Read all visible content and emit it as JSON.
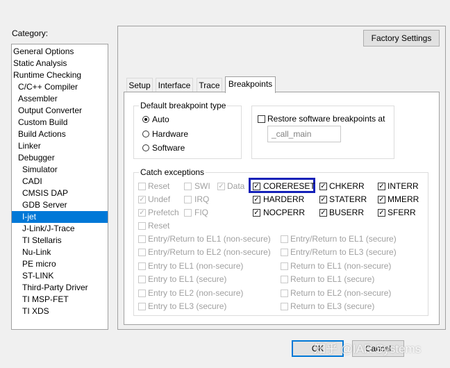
{
  "category": {
    "label": "Category:",
    "items": [
      {
        "label": "General Options",
        "level": 0
      },
      {
        "label": "Static Analysis",
        "level": 0
      },
      {
        "label": "Runtime Checking",
        "level": 0
      },
      {
        "label": "C/C++ Compiler",
        "level": 1
      },
      {
        "label": "Assembler",
        "level": 1
      },
      {
        "label": "Output Converter",
        "level": 1
      },
      {
        "label": "Custom Build",
        "level": 1
      },
      {
        "label": "Build Actions",
        "level": 1
      },
      {
        "label": "Linker",
        "level": 1
      },
      {
        "label": "Debugger",
        "level": 1
      },
      {
        "label": "Simulator",
        "level": 2
      },
      {
        "label": "CADI",
        "level": 2
      },
      {
        "label": "CMSIS DAP",
        "level": 2
      },
      {
        "label": "GDB Server",
        "level": 2
      },
      {
        "label": "I-jet",
        "level": 2,
        "selected": true
      },
      {
        "label": "J-Link/J-Trace",
        "level": 2
      },
      {
        "label": "TI Stellaris",
        "level": 2
      },
      {
        "label": "Nu-Link",
        "level": 2
      },
      {
        "label": "PE micro",
        "level": 2
      },
      {
        "label": "ST-LINK",
        "level": 2
      },
      {
        "label": "Third-Party Driver",
        "level": 2
      },
      {
        "label": "TI MSP-FET",
        "level": 2
      },
      {
        "label": "TI XDS",
        "level": 2
      }
    ]
  },
  "factory_settings": "Factory Settings",
  "tabs": [
    "Setup",
    "Interface",
    "Trace",
    "Breakpoints"
  ],
  "active_tab": "Breakpoints",
  "default_bp": {
    "title": "Default breakpoint type",
    "options": [
      {
        "label": "Auto",
        "selected": true
      },
      {
        "label": "Hardware",
        "selected": false
      },
      {
        "label": "Software",
        "selected": false
      }
    ]
  },
  "restore_bp": {
    "label": "Restore software breakpoints at",
    "checked": false,
    "value": "_call_main"
  },
  "catch": {
    "title": "Catch exceptions",
    "disabled_row1": [
      {
        "label": "Reset",
        "checked": false
      },
      {
        "label": "SWI",
        "checked": false
      },
      {
        "label": "Data",
        "checked": true
      }
    ],
    "disabled_row2": [
      {
        "label": "Undef",
        "checked": true
      },
      {
        "label": "IRQ",
        "checked": false
      }
    ],
    "disabled_row3": [
      {
        "label": "Prefetch",
        "checked": true
      },
      {
        "label": "FIQ",
        "checked": false
      }
    ],
    "disabled_row4": [
      {
        "label": "Reset",
        "checked": false
      }
    ],
    "active": [
      {
        "label": "CORERESET",
        "checked": true
      },
      {
        "label": "CHKERR",
        "checked": true
      },
      {
        "label": "INTERR",
        "checked": true
      },
      {
        "label": "HARDERR",
        "checked": true
      },
      {
        "label": "STATERR",
        "checked": true
      },
      {
        "label": "MMERR",
        "checked": true
      },
      {
        "label": "NOCPERR",
        "checked": true
      },
      {
        "label": "BUSERR",
        "checked": true
      },
      {
        "label": "SFERR",
        "checked": true
      }
    ],
    "el_left": [
      "Entry/Return to EL1 (non-secure)",
      "Entry/Return to EL2 (non-secure)",
      "Entry to EL1 (non-secure)",
      "Entry to EL1 (secure)",
      "Entry to EL2 (non-secure)",
      "Entry to EL3 (secure)"
    ],
    "el_right": [
      "Entry/Return to EL1 (secure)",
      "Entry/Return to EL3 (secure)",
      "Return to EL1 (non-secure)",
      "Return to EL1 (secure)",
      "Return to EL2 (non-secure)",
      "Return to EL3 (secure)"
    ]
  },
  "buttons": {
    "ok": "OK",
    "cancel": "Cancel"
  },
  "watermark": "知乎 @IAR Systems"
}
